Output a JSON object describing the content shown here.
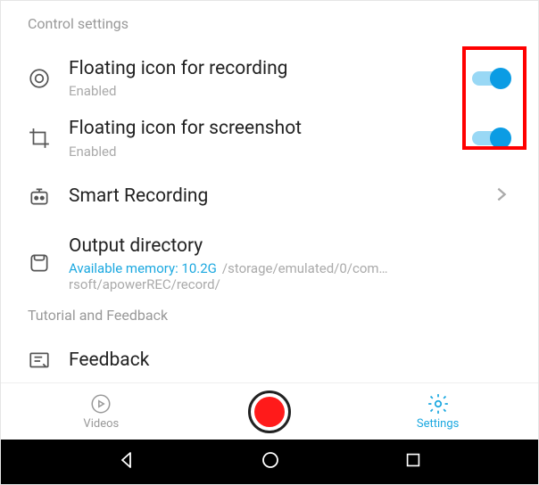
{
  "sections": {
    "control": "Control settings",
    "tutorial": "Tutorial and Feedback"
  },
  "settings": {
    "floatRecord": {
      "title": "Floating icon for recording",
      "sub": "Enabled"
    },
    "floatScreenshot": {
      "title": "Floating icon for screenshot",
      "sub": "Enabled"
    },
    "smartRecording": {
      "title": "Smart Recording"
    },
    "outputDir": {
      "title": "Output directory",
      "mem": "Available memory: 10.2G",
      "path": "/storage/emulated/0/com…rsoft/apowerREC/record/"
    },
    "feedback": {
      "title": "Feedback"
    }
  },
  "nav": {
    "videos": "Videos",
    "settings": "Settings"
  }
}
